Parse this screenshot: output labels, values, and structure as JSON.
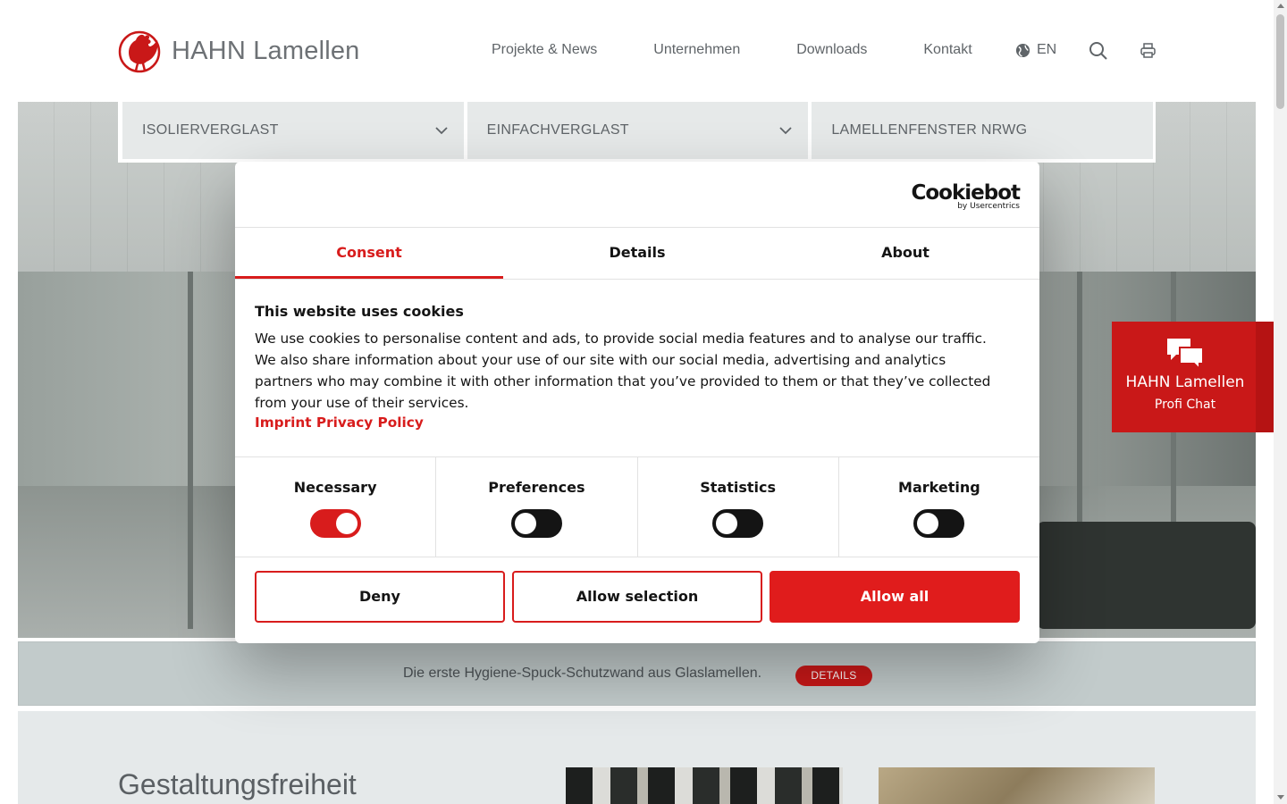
{
  "header": {
    "brand": "HAHN Lamellen",
    "nav": [
      "Projekte & News",
      "Unternehmen",
      "Downloads",
      "Kontakt"
    ],
    "language": "EN",
    "icons": {
      "logo": "rooster-logo",
      "language": "globe-icon",
      "search": "search-icon",
      "print": "print-icon"
    }
  },
  "product_menu": [
    {
      "label": "ISOLIERVERGLAST",
      "has_dropdown": true
    },
    {
      "label": "EINFACHVERGLAST",
      "has_dropdown": true
    },
    {
      "label": "LAMELLENFENSTER NRWG",
      "has_dropdown": false
    }
  ],
  "chat": {
    "title": "HAHN Lamellen",
    "subtitle": "Profi Chat",
    "icon": "chat-bubbles-icon"
  },
  "promo": {
    "text": "Die erste Hygiene-Spuck-Schutzwand aus Glaslamellen.",
    "button": "DETAILS"
  },
  "section": {
    "heading": "Gestaltungsfreiheit"
  },
  "cookie_dialog": {
    "brand": "Cookiebot",
    "brand_sub": "by Usercentrics",
    "tabs": [
      {
        "label": "Consent",
        "active": true
      },
      {
        "label": "Details",
        "active": false
      },
      {
        "label": "About",
        "active": false
      }
    ],
    "title": "This website uses cookies",
    "body": "We use cookies to personalise content and ads, to provide social media features and to analyse our traffic. We also share information about your use of our site with our social media, advertising and analytics partners who may combine it with other information that you’ve provided to them or that they’ve collected from your use of their services.",
    "links": "Imprint Privacy Policy",
    "categories": [
      {
        "label": "Necessary",
        "enabled": true
      },
      {
        "label": "Preferences",
        "enabled": false
      },
      {
        "label": "Statistics",
        "enabled": false
      },
      {
        "label": "Marketing",
        "enabled": false
      }
    ],
    "buttons": {
      "deny": "Deny",
      "allow_selection": "Allow selection",
      "allow_all": "Allow all"
    }
  },
  "colors": {
    "brand_red": "#c91818",
    "cookie_red": "#d81c1c",
    "text_gray": "#5f6468"
  }
}
